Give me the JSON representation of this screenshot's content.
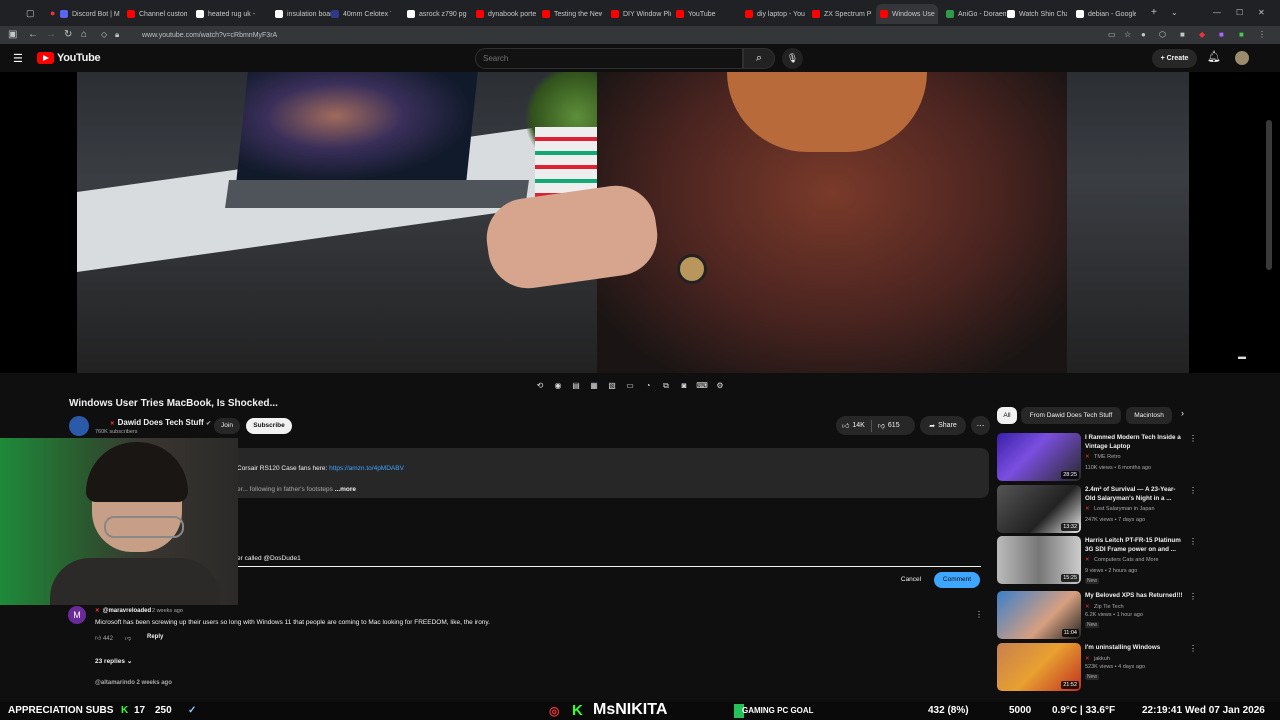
{
  "browser": {
    "tabs": [
      {
        "label": "Discord Bot | Mi",
        "color": "#5865f2"
      },
      {
        "label": "Channel customi",
        "color": "#ff0000"
      },
      {
        "label": "heated rug uk - ",
        "color": "#ffffff"
      },
      {
        "label": "insulation board",
        "color": "#ffffff"
      },
      {
        "label": "40mm Celotex Tl",
        "color": "#2d3a8c"
      },
      {
        "label": "asrock z790 pg-i",
        "color": "#ffffff"
      },
      {
        "label": "dynabook portec",
        "color": "#ff0000"
      },
      {
        "label": "Testing the New I",
        "color": "#ff0000"
      },
      {
        "label": "DIY Window Plug",
        "color": "#ff0000"
      },
      {
        "label": "YouTube",
        "color": "#ff0000"
      },
      {
        "label": "diy laptop - YouT",
        "color": "#ff0000"
      },
      {
        "label": "ZX Spectrum Plu",
        "color": "#ff0000"
      },
      {
        "label": "Windows Use",
        "color": "#ff0000"
      },
      {
        "label": "AniGo - Doraem",
        "color": "#2e9c4a"
      },
      {
        "label": "Watch Shin Chan",
        "color": "#ffffff"
      },
      {
        "label": "debian - Google",
        "color": "#ffffff"
      }
    ],
    "new_tab": "+",
    "url": "www.youtube.com/watch?v=cRbmnMyF3rA"
  },
  "header": {
    "logo": "YouTube",
    "search_placeholder": "Search",
    "create": "Create"
  },
  "video": {
    "title": "Windows User Tries MacBook, Is Shocked...",
    "channel": "Dawid Does Tech Stuff",
    "subscribers": "760K subscribers",
    "join": "Join",
    "subscribe": "Subscribe",
    "likes": "14K",
    "dislikes": "615",
    "share": "Share"
  },
  "description": {
    "line1_prefix": "Corsair RS120 Case fans here: ",
    "line1_link": "https://amzn.to/4pMDABV",
    "line2": "er... following in father's footsteps",
    "more": "...more"
  },
  "comment_box": {
    "value": "er called @DosDude1",
    "cancel": "Cancel",
    "submit": "Comment"
  },
  "comments": [
    {
      "avatar_letter": "M",
      "user": "@maravreloaded",
      "time": "2 weeks ago",
      "text": "Microsoft has been screwing up their users so long with Windows 11 that people are coming to Mac looking for FREEDOM, like, the irony.",
      "likes": "442",
      "reply": "Reply",
      "replies": "23 replies"
    }
  ],
  "comment2_user": "@altamarindo 2 weeks ago",
  "sidebar": {
    "chips": [
      "All",
      "From Dawid Does Tech Stuff",
      "Macintosh"
    ],
    "recs": [
      {
        "title": "I Rammed Modern Tech Inside a Vintage Laptop",
        "channel": "TME Retro",
        "meta": "110K views • 6 months ago",
        "duration": "28:25",
        "badge": ""
      },
      {
        "title": "2.4m² of Survival — A 23-Year-Old Salaryman's Night in a ...",
        "channel": "Lost Salaryman in Japan",
        "meta": "247K views • 7 days ago",
        "duration": "13:32",
        "badge": ""
      },
      {
        "title": "Harris Leitch PT-FR-15 Platinum 3G SDI Frame power on and ...",
        "channel": "Computers Cats and More",
        "meta": "9 views • 2 hours ago",
        "duration": "15:25",
        "badge": "New"
      },
      {
        "title": "My Beloved XPS has Returned!!!",
        "channel": "Zip Tie Tech",
        "meta": "6.2K views • 1 hour ago",
        "duration": "11:04",
        "badge": "New"
      },
      {
        "title": "I'm uninstalling Windows",
        "channel": "jakkuh",
        "meta": "523K views • 4 days ago",
        "duration": "21:52",
        "badge": "New"
      }
    ]
  },
  "ticker": {
    "appreciation": "APPRECIATION SUBS",
    "count1": "17",
    "count2": "250",
    "name": "MsNIKITA",
    "goal": "GAMING PC GOAL",
    "progress": "432 (8%)",
    "target": "5000",
    "temp": "0.9°C | 33.6°F",
    "time": "22:19:41",
    "date": "Wed 07 Jan 2026"
  }
}
